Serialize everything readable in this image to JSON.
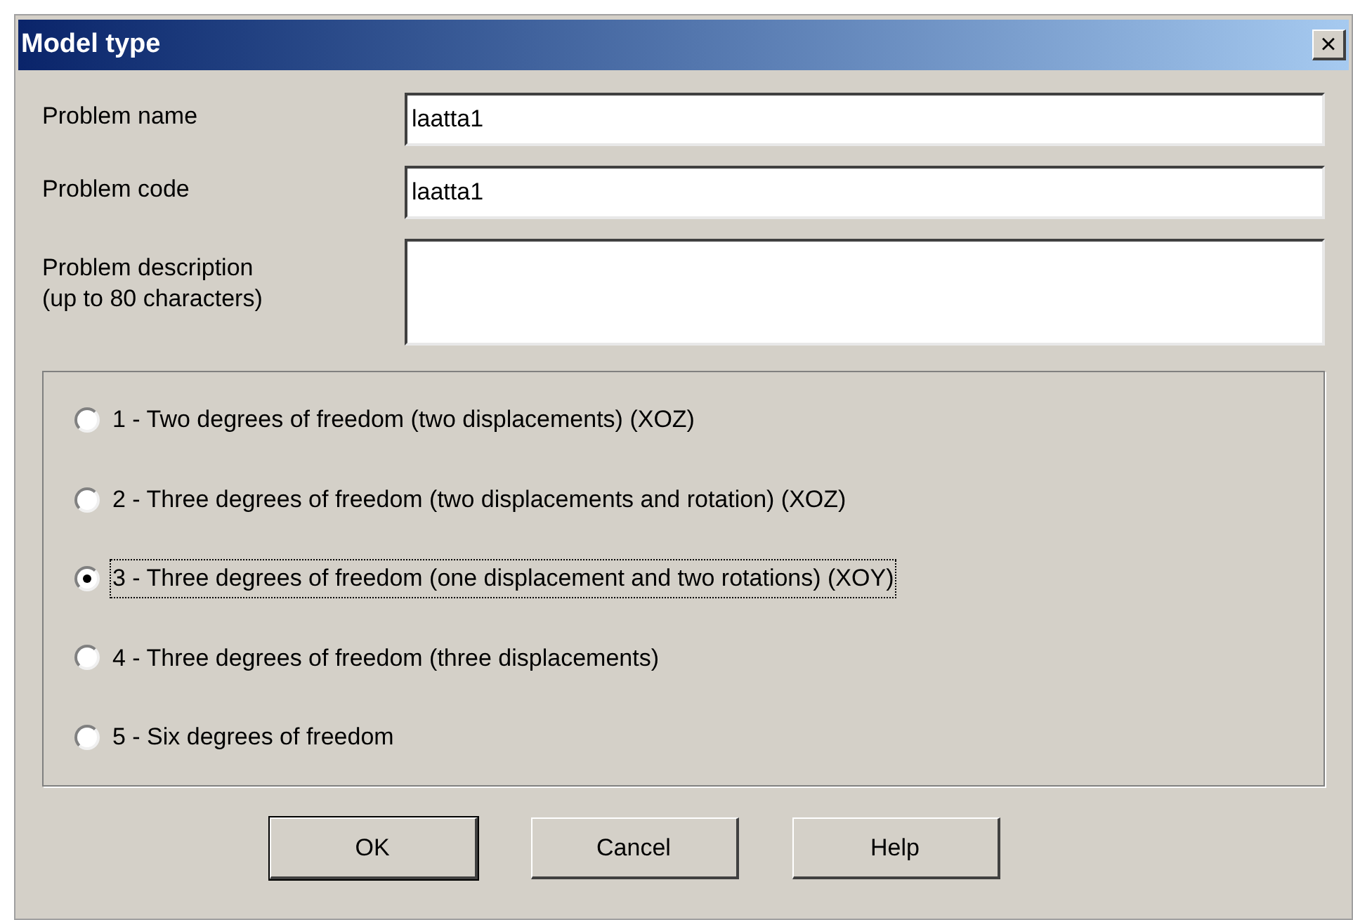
{
  "window": {
    "title": "Model type",
    "close": "×"
  },
  "fields": [
    {
      "kind": "line",
      "label": "Problem name",
      "value": "laatta1"
    },
    {
      "kind": "line",
      "label": "Problem code",
      "value": "laatta1"
    },
    {
      "kind": "area",
      "label": "Problem description\n(up to 80 characters)"
    }
  ],
  "options": [
    {
      "label": "1 - Two degrees of freedom (two displacements) (XOZ)",
      "selected": false
    },
    {
      "label": "2 - Three degrees of freedom (two displacements and rotation) (XOZ)",
      "selected": false
    },
    {
      "label": "3 - Three degrees of freedom (one displacement and two rotations) (XOY)",
      "selected": true
    },
    {
      "label": "4 - Three degrees of freedom (three displacements)",
      "selected": false
    },
    {
      "label": "5 - Six degrees of freedom",
      "selected": false
    }
  ],
  "buttons": [
    {
      "label": "OK",
      "default": true
    },
    {
      "label": "Cancel",
      "default": false
    },
    {
      "label": "Help",
      "default": false
    }
  ]
}
